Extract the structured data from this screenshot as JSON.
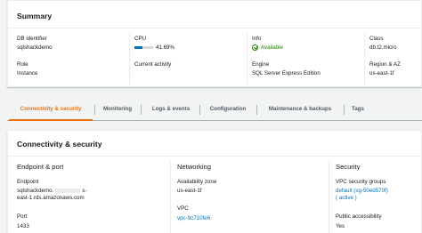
{
  "summary": {
    "title": "Summary",
    "db_identifier": {
      "label": "DB identifier",
      "value": "sqlshackdemo"
    },
    "role": {
      "label": "Role",
      "value": "Instance"
    },
    "cpu": {
      "label": "CPU",
      "value": "41.69%",
      "fill_fraction": 0.4169
    },
    "current_activity": {
      "label": "Current activity"
    },
    "info": {
      "label": "Info",
      "value": "Available"
    },
    "engine": {
      "label": "Engine",
      "value": "SQL Server Express Edition"
    },
    "class": {
      "label": "Class",
      "value": "db.t2.micro"
    },
    "region": {
      "label": "Region & AZ",
      "value": "us-east-1f"
    }
  },
  "tabs": [
    {
      "label": "Connectivity & security",
      "active": true
    },
    {
      "label": "Monitoring",
      "active": false
    },
    {
      "label": "Logs & events",
      "active": false
    },
    {
      "label": "Configuration",
      "active": false
    },
    {
      "label": "Maintenance & backups",
      "active": false
    },
    {
      "label": "Tags",
      "active": false
    }
  ],
  "connectivity": {
    "title": "Connectivity & security",
    "endpoint_port": {
      "heading": "Endpoint & port",
      "endpoint_label": "Endpoint",
      "endpoint_line1_start": "sqlshackdemo.",
      "endpoint_line1_end": "s-",
      "endpoint_line2": "east-1.rds.amazonaws.com",
      "port_label": "Port",
      "port_value": "1433"
    },
    "networking": {
      "heading": "Networking",
      "az_label": "Availability zone",
      "az_value": "us-east-1f",
      "vpc_label": "VPC",
      "vpc_value": "vpc-9c710fe6"
    },
    "security": {
      "heading": "Security",
      "sg_label": "VPC security groups",
      "sg_value_line1": "default (sg-50ed570f)",
      "sg_value_line2": "( active )",
      "public_label": "Public accessibility",
      "public_value": "Yes"
    }
  },
  "colors": {
    "accent": "#ec7211",
    "link": "#0073bb",
    "success": "#1d8102"
  }
}
